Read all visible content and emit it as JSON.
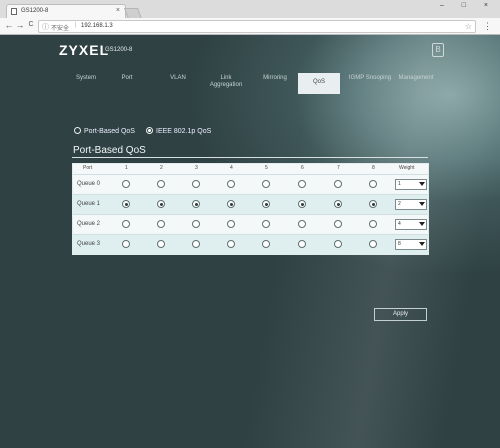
{
  "browser": {
    "tab_title": "GS1200-8",
    "tab_close": "×",
    "window_controls": "– □ ×",
    "nav": {
      "back": "←",
      "forward": "→",
      "reload": "C"
    },
    "address": {
      "security_label": "不安全",
      "separator": "|",
      "url": "192.168.1.3"
    }
  },
  "header": {
    "logo": "ZYXEL",
    "model": "GS1200-8",
    "logout_glyph": "B"
  },
  "menu": [
    {
      "label": "System"
    },
    {
      "label": "Port"
    },
    {
      "label": "VLAN"
    },
    {
      "label": "Link Aggregation"
    },
    {
      "label": "Mirroring"
    },
    {
      "label": "QoS",
      "active": true
    },
    {
      "label": "IGMP Snooping"
    },
    {
      "label": "Management"
    }
  ],
  "qos_mode": {
    "port_based": {
      "label": "Port-Based QoS",
      "selected": false
    },
    "ieee": {
      "label": "IEEE 802.1p QoS",
      "selected": true
    }
  },
  "section_title": "Port-Based QoS",
  "table": {
    "columns": [
      "Port",
      "1",
      "2",
      "3",
      "4",
      "5",
      "6",
      "7",
      "8",
      "Weight"
    ],
    "rows": [
      {
        "label": "Queue 0",
        "selected_ports": [],
        "weight": "1"
      },
      {
        "label": "Queue 1",
        "selected_ports": [
          1,
          2,
          3,
          4,
          5,
          6,
          7,
          8
        ],
        "weight": "2"
      },
      {
        "label": "Queue 2",
        "selected_ports": [],
        "weight": "4"
      },
      {
        "label": "Queue 3",
        "selected_ports": [],
        "weight": "8"
      }
    ]
  },
  "apply_label": "Apply",
  "colors": {
    "page_bg": "#3f5759",
    "table_bg": "#f4f8f8",
    "active_menu": "#e9eff0"
  }
}
